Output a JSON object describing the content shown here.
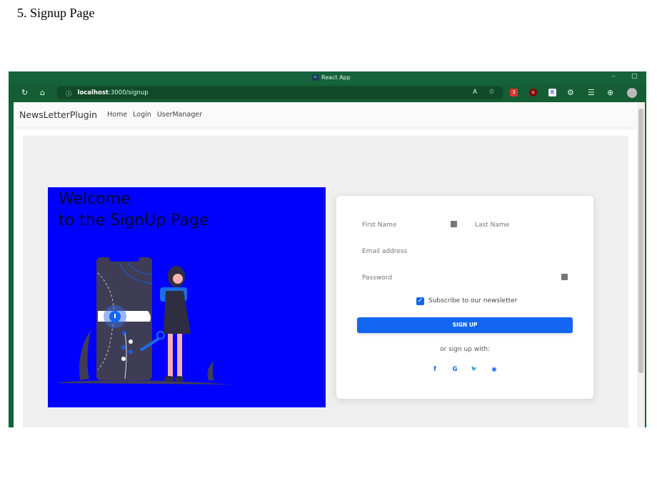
{
  "document": {
    "heading": "5.   Signup Page"
  },
  "browser": {
    "title": "React App",
    "url_host": "localhost",
    "url_path": ":3000/signup",
    "minimize": "–",
    "restore": "▢",
    "extension_badge": "3"
  },
  "navbar": {
    "brand": "NewsLetterPlugin",
    "links": [
      "Home",
      "Login",
      "UserManager"
    ]
  },
  "hero": {
    "line1": "Welcome",
    "line2": "to the SignUp Page",
    "background": "#0000fe"
  },
  "form": {
    "first_name": "First Name",
    "last_name": "Last Name",
    "email": "Email address",
    "password": "Password",
    "subscribe_label": "Subscribe to our newsletter",
    "subscribe_checked": true,
    "submit": "SIGN UP",
    "alt_text": "or sign up with:",
    "social": [
      {
        "icon": "facebook-icon",
        "glyph": "f"
      },
      {
        "icon": "google-icon",
        "glyph": "G"
      },
      {
        "icon": "twitter-icon",
        "glyph": "🐦"
      },
      {
        "icon": "github-icon",
        "glyph": "◉"
      }
    ]
  },
  "colors": {
    "accent": "#1266f1",
    "browser_frame": "#14633a"
  }
}
